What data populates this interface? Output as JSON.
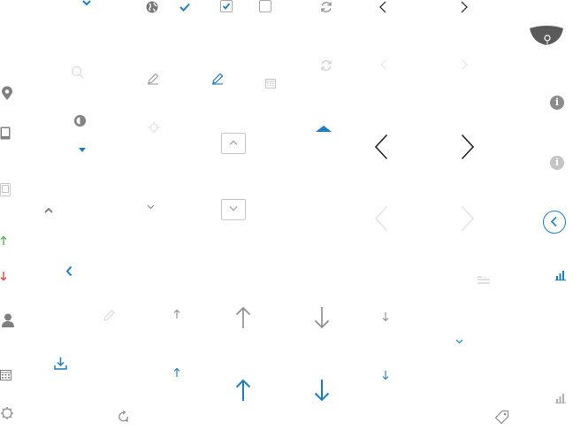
{
  "colors": {
    "blue": "#1b7fc4",
    "gray": "#8c8c8c",
    "dark": "#333333",
    "light": "#d8dde6",
    "green": "#5cb85c",
    "red": "#d9534f"
  },
  "icons": [
    "chevron-down-icon",
    "globe-icon",
    "checkmark-icon",
    "checkbox-checked-icon",
    "checkbox-empty-icon",
    "refresh-icon",
    "chevron-left-icon",
    "chevron-right-icon",
    "location-pin-icon",
    "tablet-icon",
    "user-icon",
    "calendar-icon",
    "download-icon",
    "pencil-icon",
    "arrow-up-icon",
    "arrow-down-icon",
    "caret-up-icon",
    "caret-down-icon",
    "info-icon",
    "bar-chart-icon",
    "tag-icon",
    "rotate-icon",
    "gear-icon",
    "search-icon"
  ]
}
